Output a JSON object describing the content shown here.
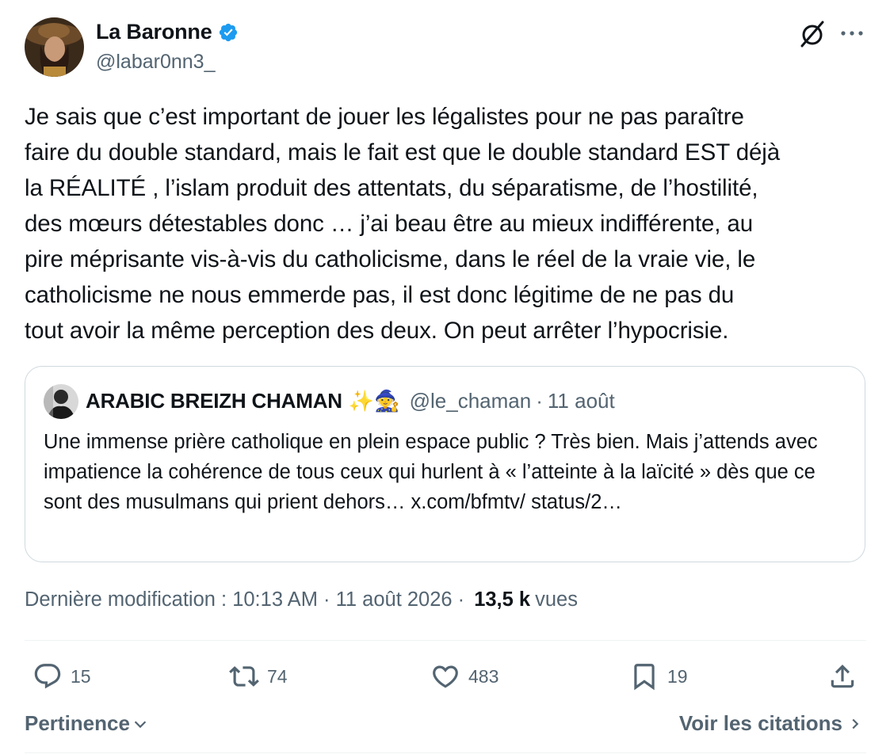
{
  "author": {
    "display_name": "La Baronne",
    "handle": "@labar0nn3_",
    "verified": true
  },
  "tweet": {
    "text": "Je sais que c’est important de jouer les légalistes pour ne pas paraître\nfaire du double standard, mais le fait est que le double standard EST déjà\nla RÉALITÉ , l’islam produit des attentats, du séparatisme, de l’hostilité,\ndes mœurs détestables donc … j’ai beau être au mieux indifférente, au\npire méprisante vis-à-vis du catholicisme, dans le réel de la vraie vie, le\ncatholicisme ne nous emmerde pas, il est donc légitime de ne pas du\ntout avoir la même perception des deux. On peut arrêter l’hypocrisie."
  },
  "quote": {
    "display_name": "ARABIC BREIZH CHAMAN",
    "emoji": "✨🧙",
    "handle": "@le_chaman",
    "separator": "·",
    "date": "11 août",
    "text": "Une immense prière catholique en plein espace public ? Très bien. Mais j’attends avec impatience la cohérence de tous ceux qui hurlent à « l’atteinte à la laïcité » dès que ce sont des musulmans qui prient dehors… x.com/bfmtv/ status/2…"
  },
  "meta": {
    "edited_label": "Dernière modification : 10:13 AM · 11 août 2026 ·",
    "views_count": "13,5 k",
    "views_label": "vues"
  },
  "actions": {
    "replies": "15",
    "reposts": "74",
    "likes": "483",
    "bookmarks": "19"
  },
  "footer": {
    "sort_label": "Pertinence",
    "quotes_link": "Voir les citations"
  },
  "colors": {
    "verified_blue": "#1d9bf0",
    "secondary_text": "#536471",
    "border": "#cfd9de"
  },
  "icons": [
    "verified-badge-icon",
    "grok-icon",
    "more-icon",
    "reply-icon",
    "repost-icon",
    "like-icon",
    "bookmark-icon",
    "share-icon",
    "chevron-down-icon",
    "chevron-right-icon"
  ]
}
